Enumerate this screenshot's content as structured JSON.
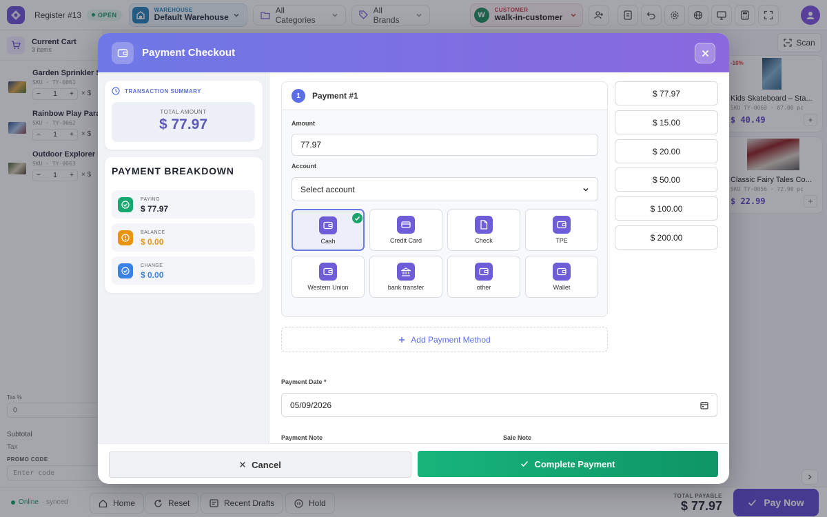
{
  "topbar": {
    "register": "Register #13",
    "register_status": "OPEN",
    "warehouse_label": "WAREHOUSE",
    "warehouse_value": "Default Warehouse",
    "categories": "All Categories",
    "brands": "All Brands",
    "customer_label": "CUSTOMER",
    "customer_initial": "W",
    "customer_value": "walk-in-customer"
  },
  "cart": {
    "title": "Current Cart",
    "count": "3 items",
    "items": [
      {
        "name": "Garden Sprinkler S",
        "sku": "SKU · TY-0061",
        "qty": "1",
        "minus": "−",
        "plus": "+",
        "x": "× $"
      },
      {
        "name": "Rainbow Play Para",
        "sku": "SKU · TY-0062",
        "qty": "1",
        "minus": "−",
        "plus": "+",
        "x": "× $"
      },
      {
        "name": "Outdoor Explorer K",
        "sku": "SKU · TY-0063",
        "qty": "1",
        "minus": "−",
        "plus": "+",
        "x": "× $"
      }
    ],
    "tax_label": "Tax %",
    "tax_value": "0",
    "subtotal_label": "Subtotal",
    "tax_row_label": "Tax",
    "promo_label": "PROMO CODE",
    "promo_placeholder": "Enter code"
  },
  "products": {
    "scan": "Scan",
    "items": [
      {
        "name": "Kids Skateboard – Sta...",
        "sku": "SKU TY-0060 · 87.00 pc",
        "price": "$ 40.49",
        "discount": "-10%",
        "add": "+"
      },
      {
        "name": "Classic Fairy Tales Co...",
        "sku": "SKU TY-0056 · 72.90 pc",
        "price": "$ 22.99",
        "discount": "",
        "add": "+"
      }
    ]
  },
  "bottom": {
    "online": "Online",
    "synced": "· synced",
    "home": "Home",
    "reset": "Reset",
    "drafts": "Recent Drafts",
    "hold": "Hold",
    "total_label": "TOTAL PAYABLE",
    "total_value": "$ 77.97",
    "pay_now": "Pay Now"
  },
  "modal": {
    "title": "Payment Checkout",
    "summary": {
      "header": "TRANSACTION SUMMARY",
      "total_label": "TOTAL AMOUNT",
      "total_value": "$ 77.97"
    },
    "breakdown": {
      "title": "PAYMENT BREAKDOWN",
      "paying_label": "PAYING",
      "paying_value": "$ 77.97",
      "balance_label": "BALANCE",
      "balance_value": "$ 0.00",
      "change_label": "CHANGE",
      "change_value": "$ 0.00"
    },
    "payment": {
      "number": "1",
      "title": "Payment #1",
      "amount_label": "Amount",
      "amount_value": "77.97",
      "account_label": "Account",
      "account_value": "Select account",
      "methods": [
        "Cash",
        "Credit Card",
        "Check",
        "TPE",
        "Western Union",
        "bank transfer",
        "other",
        "Wallet"
      ],
      "selected_method": "Cash"
    },
    "add_method": "Add Payment Method",
    "quick_amounts": [
      "$ 77.97",
      "$ 15.00",
      "$ 20.00",
      "$ 50.00",
      "$ 100.00",
      "$ 200.00"
    ],
    "date_label": "Payment Date *",
    "date_value": "05/09/2026",
    "payment_note_label": "Payment Note",
    "sale_note_label": "Sale Note",
    "cancel": "Cancel",
    "complete": "Complete Payment"
  },
  "colors": {
    "header_start": "#6e78e6",
    "header_end": "#8a68de",
    "accent": "#5b6ee8",
    "success": "#17b57b",
    "warning": "#e89412",
    "info": "#3a82e6",
    "brand": "#5b45cf"
  }
}
